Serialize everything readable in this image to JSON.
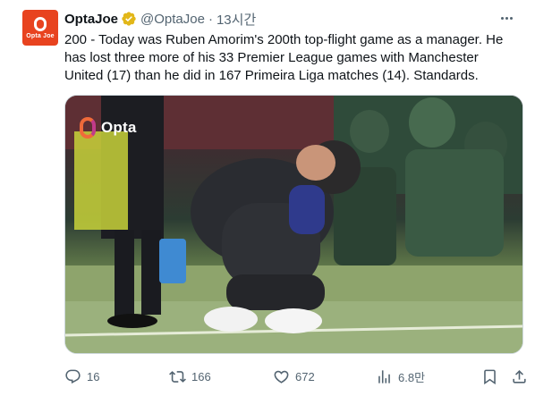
{
  "tweet": {
    "avatar_text": "Opta Joe",
    "display_name": "OptaJoe",
    "handle": "@OptaJoe",
    "separator": "·",
    "time": "13시간",
    "body": "200 - Today was Ruben Amorim's 200th top-flight game as a manager. He has lost three more of his 33 Premier League games with Manchester United (17) than he did in 167 Primeira Liga matches (14). Standards.",
    "media": {
      "watermark": "Opta"
    },
    "stats": {
      "replies": "16",
      "reposts": "166",
      "likes": "672",
      "views": "6.8만"
    }
  },
  "colors": {
    "accent_orange": "#e8431f",
    "verified_gold": "#e2b719",
    "secondary_text": "#536471"
  },
  "icons": {
    "more": "more-icon",
    "verified": "verified-badge-icon",
    "reply": "reply-icon",
    "repost": "repost-icon",
    "like": "heart-icon",
    "views": "views-icon",
    "bookmark": "bookmark-icon",
    "share": "share-icon"
  }
}
